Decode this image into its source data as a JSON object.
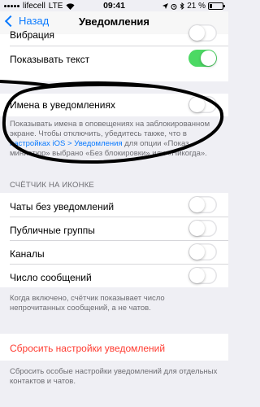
{
  "status_bar": {
    "carrier": "lifecell",
    "network": "LTE",
    "time": "09:41",
    "battery_percent": "21 %",
    "battery_level": 0.21
  },
  "nav": {
    "back_label": "Назад",
    "title": "Уведомления"
  },
  "rows": {
    "vibration_label": "Вибрация",
    "show_text_label": "Показывать текст",
    "show_text_on": true,
    "names_label": "Имена в уведомлениях",
    "names_on": false
  },
  "names_footer": {
    "text_before_link": "Показывать имена в оповещениях на заблокированном экране. Чтобы отключить, убедитесь также, что в ",
    "link": "настройках iOS > Уведомления",
    "text_after_link": " для опции «Показ миниатюр» выбрано «Без блокировки» или «Никогда»."
  },
  "counter_section": {
    "header": "СЧЁТЧИК НА ИКОНКЕ",
    "items": [
      {
        "label": "Чаты без уведомлений",
        "on": false
      },
      {
        "label": "Публичные группы",
        "on": false
      },
      {
        "label": "Каналы",
        "on": false
      },
      {
        "label": "Число сообщений",
        "on": false
      }
    ],
    "footer": "Когда включено, счётчик показывает число непрочитанных сообщений, а не чатов."
  },
  "reset": {
    "label": "Сбросить настройки уведомлений",
    "footer": "Сбросить особые настройки уведомлений для отдельных контактов и чатов."
  },
  "colors": {
    "accent": "#0a7aff",
    "toggle_on": "#4cd964",
    "destructive": "#ff3b30",
    "background": "#efeff4"
  }
}
